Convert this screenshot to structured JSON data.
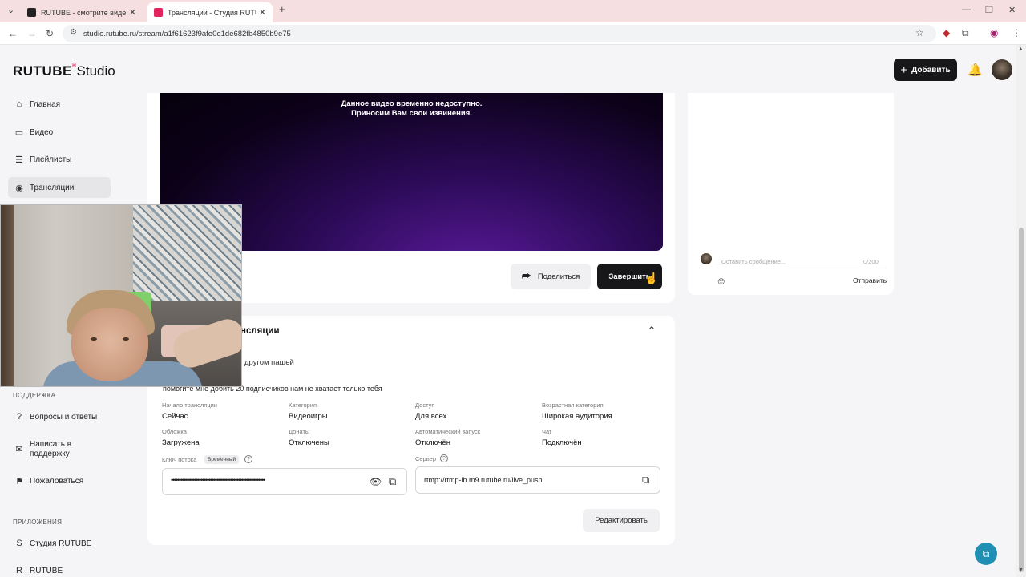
{
  "browser": {
    "tabs": [
      {
        "title": "RUTUBE - смотрите видео онл",
        "active": false
      },
      {
        "title": "Трансляции - Студия RUTUBE",
        "active": true
      }
    ],
    "url": "studio.rutube.ru/stream/a1f61623f9afe0e1de682fb4850b9e75"
  },
  "header": {
    "logo_main": "RUTUBE",
    "logo_reg": "®",
    "logo_studio": "Studio",
    "add_button": "Добавить"
  },
  "sidebar": {
    "items": [
      {
        "label": "Главная",
        "icon": "home-icon"
      },
      {
        "label": "Видео",
        "icon": "video-icon"
      },
      {
        "label": "Плейлисты",
        "icon": "playlist-icon"
      },
      {
        "label": "Трансляции",
        "icon": "broadcast-icon",
        "active": true
      }
    ],
    "support_title": "ПОДДЕРЖКА",
    "support_items": [
      {
        "label": "Вопросы и ответы",
        "icon": "question-icon"
      },
      {
        "label": "Написать в поддержку",
        "icon": "mail-icon"
      },
      {
        "label": "Пожаловаться",
        "icon": "flag-icon"
      }
    ],
    "apps_title": "ПРИЛОЖЕНИЯ",
    "apps_items": [
      {
        "label": "Студия RUTUBE",
        "icon": "studio-app-icon"
      },
      {
        "label": "RUTUBE",
        "icon": "rutube-app-icon"
      }
    ]
  },
  "player": {
    "message_line1": "Данное видео временно недоступно.",
    "message_line2": "Приносим Вам свои извинения.",
    "share_button": "Поделиться",
    "finish_button": "Завершить"
  },
  "chat": {
    "placeholder": "Оставить сообщение...",
    "counter": "0/200",
    "send": "Отправить"
  },
  "details": {
    "title_visible": "нсляции",
    "line_visible": "другом пашей",
    "description": "помогите мне добить 20 подписчиков нам не хватает только тебя",
    "fields": [
      {
        "label": "Начало трансляции",
        "value": "Сейчас"
      },
      {
        "label": "Категория",
        "value": "Видеоигры"
      },
      {
        "label": "Доступ",
        "value": "Для всех"
      },
      {
        "label": "Возрастная категория",
        "value": "Широкая аудитория"
      },
      {
        "label": "Обложка",
        "value": "Загружена"
      },
      {
        "label": "Донаты",
        "value": "Отключены"
      },
      {
        "label": "Автоматический запуск",
        "value": "Отключён"
      },
      {
        "label": "Чат",
        "value": "Подключён"
      }
    ],
    "stream_key_label": "Ключ потока",
    "stream_key_badge": "Временный",
    "stream_key_masked": "••••••••••••••••••••••••••••••••••••••••••••••••••••••••••••",
    "server_label": "Сервер",
    "server_value": "rtmp://rtmp-lb.m9.rutube.ru/live_push",
    "edit_button": "Редактировать"
  }
}
